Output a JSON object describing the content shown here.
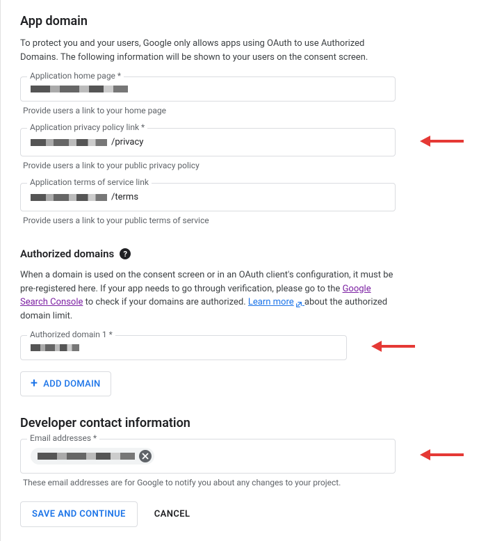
{
  "app_domain": {
    "title": "App domain",
    "description": "To protect you and your users, Google only allows apps using OAuth to use Authorized Domains. The following information will be shown to your users on the consent screen.",
    "home_page": {
      "label": "Application home page *",
      "value": "",
      "helper": "Provide users a link to your home page"
    },
    "privacy_policy": {
      "label": "Application privacy policy link *",
      "value_suffix": "/privacy",
      "helper": "Provide users a link to your public privacy policy"
    },
    "terms_of_service": {
      "label": "Application terms of service link",
      "value_suffix": "/terms",
      "helper": "Provide users a link to your public terms of service"
    }
  },
  "authorized_domains": {
    "title": "Authorized domains",
    "description_pre": "When a domain is used on the consent screen or in an OAuth client's configuration, it must be pre-registered here. If your app needs to go through verification, please go to the ",
    "link_gsc": "Google Search Console",
    "description_mid": " to check if your domains are authorized. ",
    "link_learn": "Learn more",
    "description_post": " about the authorized domain limit.",
    "domain1_label": "Authorized domain 1 *",
    "add_button": "ADD DOMAIN"
  },
  "developer_contact": {
    "title": "Developer contact information",
    "email_label": "Email addresses *",
    "helper": "These email addresses are for Google to notify you about any changes to your project."
  },
  "buttons": {
    "save": "SAVE AND CONTINUE",
    "cancel": "CANCEL"
  },
  "colors": {
    "arrow": "#e53935",
    "primary": "#1a73e8"
  }
}
